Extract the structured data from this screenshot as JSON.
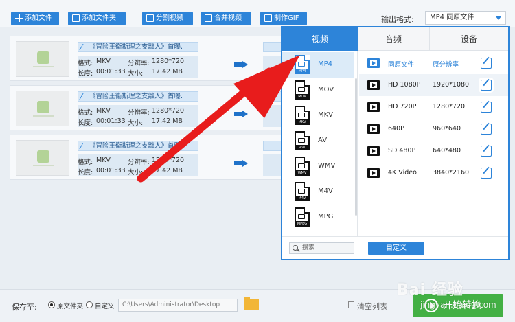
{
  "toolbar": {
    "add_file": "添加文件",
    "add_folder": "添加文件夹",
    "split_video": "分割视频",
    "merge_video": "合并视频",
    "make_gif": "制作GIF",
    "output_format_label": "输出格式:",
    "output_format_value": "MP4  同原文件"
  },
  "files": [
    {
      "name": "《冒险王衞斯理之支離人》首曝.",
      "format_label": "格式:",
      "format": "MKV",
      "res_label": "分辨率:",
      "resolution": "1280*720",
      "duration_label": "长度:",
      "duration": "00:01:33",
      "size_label": "大小:",
      "size": "17.42 MB"
    },
    {
      "name": "《冒险王衞斯理之支離人》首曝.",
      "format_label": "格式:",
      "format": "MKV",
      "res_label": "分辨率:",
      "resolution": "1280*720",
      "duration_label": "长度:",
      "duration": "00:01:33",
      "size_label": "大小:",
      "size": "17.42 MB"
    },
    {
      "name": "《冒险王衞斯理之支離人》首曝.",
      "format_label": "格式:",
      "format": "MKV",
      "res_label": "分辨率:",
      "resolution": "1280*720",
      "duration_label": "长度:",
      "duration": "00:01:33",
      "size_label": "大小:",
      "size": "17.42 MB"
    }
  ],
  "popup": {
    "tabs": [
      "视频",
      "音频",
      "设备"
    ],
    "active_tab": "视频",
    "formats": [
      {
        "name": "MP4",
        "tag": "MP4"
      },
      {
        "name": "MOV",
        "tag": "MOV"
      },
      {
        "name": "MKV",
        "tag": "MKV"
      },
      {
        "name": "AVI",
        "tag": "AVI"
      },
      {
        "name": "WMV",
        "tag": "WMV"
      },
      {
        "name": "M4V",
        "tag": "M4V"
      },
      {
        "name": "MPG",
        "tag": "MPEG"
      }
    ],
    "selected_format": "MP4",
    "resolutions": [
      {
        "name": "同原文件",
        "dim": "原分辨率"
      },
      {
        "name": "HD 1080P",
        "dim": "1920*1080"
      },
      {
        "name": "HD 720P",
        "dim": "1280*720"
      },
      {
        "name": "640P",
        "dim": "960*640"
      },
      {
        "name": "SD 480P",
        "dim": "640*480"
      },
      {
        "name": "4K Video",
        "dim": "3840*2160"
      }
    ],
    "search_placeholder": "搜索",
    "custom_button": "自定义"
  },
  "footer": {
    "save_to_label": "保存至:",
    "option_source_folder": "原文件夹",
    "option_custom": "自定义",
    "path": "C:\\Users\\Administrator\\Desktop",
    "clear_list": "清空列表",
    "start_convert": "开始转换"
  },
  "watermark": {
    "text": "Bai 经验",
    "sub": "jingyan.baidu.com"
  },
  "colors": {
    "accent": "#2d84d9",
    "start": "#43b044",
    "annotation_arrow": "#e81c1c"
  }
}
